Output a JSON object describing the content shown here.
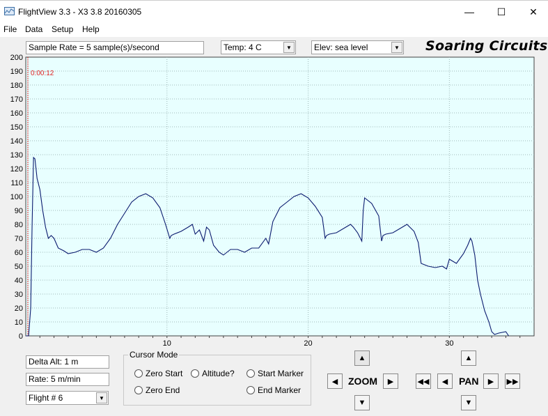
{
  "window": {
    "title": "FlightView 3.3 - X3 3.8  20160305",
    "minimize_glyph": "—",
    "maximize_glyph": "☐",
    "close_glyph": "✕"
  },
  "menu": [
    "File",
    "Data",
    "Setup",
    "Help"
  ],
  "toolbar": {
    "sample_rate": "Sample Rate =  5 sample(s)/second",
    "temp": "Temp:  4 C",
    "elev": "Elev: sea level",
    "brand": "Soaring Circuits"
  },
  "chart_data": {
    "type": "line",
    "timestamp": "0:00:12",
    "ylim": [
      0,
      200
    ],
    "yticks": [
      0,
      10,
      20,
      30,
      40,
      50,
      60,
      70,
      80,
      90,
      100,
      110,
      120,
      130,
      140,
      150,
      160,
      170,
      180,
      190,
      200
    ],
    "xlim": [
      0,
      36
    ],
    "xticks": [
      10,
      20,
      30
    ],
    "grid": true,
    "colors": {
      "background": "#e8ffff",
      "line": "#0a1a6e",
      "marker": "#e02020"
    },
    "series": [
      {
        "x": [
          0,
          0.2,
          0.35,
          0.45,
          0.55,
          0.65,
          0.8,
          1.0,
          1.2,
          1.4,
          1.6,
          1.8,
          2.0,
          2.3,
          2.7,
          3.0,
          3.5,
          4.0,
          4.5,
          5.0,
          5.5,
          6.0,
          6.5,
          7.0,
          7.5,
          8.0,
          8.5,
          9.0,
          9.5,
          9.9,
          10.2,
          10.3,
          10.5,
          11.0,
          11.5,
          11.8,
          12.0,
          12.3,
          12.6,
          12.8,
          13.0,
          13.3,
          13.7,
          14.0,
          14.5,
          15.0,
          15.5,
          16.0,
          16.5,
          17.0,
          17.2,
          17.5,
          18.0,
          18.5,
          19.0,
          19.5,
          20.0,
          20.5,
          21.0,
          21.2,
          21.3,
          21.5,
          22.0,
          22.5,
          23.0,
          23.2,
          23.5,
          23.8,
          23.9,
          24.0,
          24.5,
          25.0,
          25.2,
          25.3,
          25.5,
          26.0,
          26.5,
          27.0,
          27.5,
          27.8,
          28.0,
          28.5,
          29.0,
          29.5,
          29.8,
          30.0,
          30.5,
          31.0,
          31.3,
          31.5,
          31.6,
          31.8,
          32.0,
          32.2,
          32.5,
          32.8,
          33.0,
          33.2,
          33.5,
          34.0,
          34.2
        ],
        "y": [
          0,
          0,
          20,
          80,
          128,
          127,
          113,
          105,
          90,
          78,
          70,
          72,
          70,
          63,
          61,
          59,
          60,
          62,
          62,
          60,
          63,
          70,
          80,
          88,
          96,
          100,
          102,
          99,
          92,
          80,
          70,
          72,
          73,
          75,
          78,
          80,
          73,
          76,
          68,
          78,
          76,
          65,
          60,
          58,
          62,
          62,
          60,
          63,
          63,
          70,
          66,
          82,
          92,
          96,
          100,
          102,
          99,
          93,
          85,
          70,
          72,
          73,
          74,
          77,
          80,
          78,
          74,
          68,
          90,
          99,
          95,
          86,
          68,
          72,
          73,
          74,
          77,
          80,
          75,
          67,
          52,
          50,
          49,
          50,
          48,
          55,
          52,
          59,
          65,
          70,
          68,
          58,
          40,
          30,
          18,
          10,
          3,
          1,
          2,
          3,
          0
        ]
      }
    ]
  },
  "bottom": {
    "delta_alt": "Delta Alt: 1 m",
    "rate": "Rate: 5 m/min",
    "flight": "Flight # 6"
  },
  "cursor_mode": {
    "title": "Cursor Mode",
    "options": [
      "Zero Start",
      "Altitude?",
      "Start Marker",
      "Zero End",
      "End Marker"
    ]
  },
  "zoom": {
    "label": "ZOOM",
    "up": "▲",
    "down": "▼",
    "left": "◀",
    "right": "▶"
  },
  "pan": {
    "label": "PAN",
    "up": "▲",
    "down": "▼",
    "left": "◀",
    "right": "▶",
    "fast_left": "◀◀",
    "fast_right": "▶▶"
  },
  "icons": {
    "dropdown": "▼"
  }
}
